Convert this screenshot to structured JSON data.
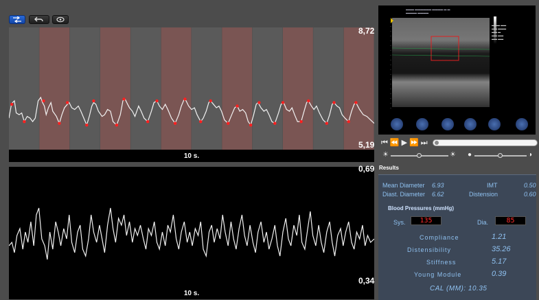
{
  "toolbar": {
    "buttons": [
      {
        "icon": "compare-icon",
        "active": true
      },
      {
        "icon": "undo-icon",
        "active": false
      },
      {
        "icon": "eye-icon",
        "active": false
      }
    ]
  },
  "top_chart": {
    "max_label": "8,72",
    "min_label": "5,19",
    "caption": "10 s.",
    "ylim": [
      5.19,
      8.72
    ],
    "duration_s": 10,
    "band_colors": [
      "#5a5a5a",
      "#7a5553"
    ],
    "bands": [
      0,
      1,
      0,
      1,
      0,
      1,
      0,
      1,
      0,
      1,
      0,
      1
    ],
    "series": [
      [
        0.0,
        6.1
      ],
      [
        0.06,
        6.45
      ],
      [
        0.1,
        6.55
      ],
      [
        0.15,
        6.6
      ],
      [
        0.2,
        6.25
      ],
      [
        0.28,
        6.2
      ],
      [
        0.35,
        6.25
      ],
      [
        0.42,
        6.0
      ],
      [
        0.5,
        6.15
      ],
      [
        0.58,
        6.1
      ],
      [
        0.65,
        6.0
      ],
      [
        0.72,
        6.1
      ],
      [
        0.8,
        6.6
      ],
      [
        0.87,
        6.7
      ],
      [
        0.92,
        6.55
      ],
      [
        0.97,
        6.45
      ],
      [
        1.02,
        6.2
      ],
      [
        1.08,
        6.4
      ],
      [
        1.15,
        6.55
      ],
      [
        1.2,
        6.3
      ],
      [
        1.3,
        6.15
      ],
      [
        1.38,
        5.95
      ],
      [
        1.45,
        6.2
      ],
      [
        1.52,
        6.4
      ],
      [
        1.6,
        6.5
      ],
      [
        1.65,
        6.55
      ],
      [
        1.72,
        6.4
      ],
      [
        1.8,
        6.35
      ],
      [
        1.9,
        6.45
      ],
      [
        1.97,
        6.3
      ],
      [
        2.05,
        6.1
      ],
      [
        2.13,
        5.9
      ],
      [
        2.2,
        6.15
      ],
      [
        2.27,
        6.45
      ],
      [
        2.32,
        6.55
      ],
      [
        2.38,
        6.5
      ],
      [
        2.45,
        6.3
      ],
      [
        2.55,
        6.15
      ],
      [
        2.62,
        6.2
      ],
      [
        2.7,
        6.35
      ],
      [
        2.78,
        6.3
      ],
      [
        2.85,
        6.0
      ],
      [
        2.95,
        5.9
      ],
      [
        3.05,
        6.2
      ],
      [
        3.12,
        6.6
      ],
      [
        3.18,
        6.65
      ],
      [
        3.25,
        6.5
      ],
      [
        3.3,
        6.4
      ],
      [
        3.38,
        6.3
      ],
      [
        3.45,
        6.15
      ],
      [
        3.55,
        6.45
      ],
      [
        3.62,
        6.3
      ],
      [
        3.7,
        6.1
      ],
      [
        3.8,
        6.0
      ],
      [
        3.9,
        6.3
      ],
      [
        3.97,
        6.55
      ],
      [
        4.05,
        6.6
      ],
      [
        4.12,
        6.45
      ],
      [
        4.2,
        6.35
      ],
      [
        4.28,
        6.5
      ],
      [
        4.35,
        6.35
      ],
      [
        4.45,
        6.1
      ],
      [
        4.55,
        5.95
      ],
      [
        4.65,
        6.2
      ],
      [
        4.72,
        6.45
      ],
      [
        4.8,
        6.65
      ],
      [
        4.85,
        6.6
      ],
      [
        4.92,
        6.45
      ],
      [
        5.0,
        6.35
      ],
      [
        5.08,
        6.4
      ],
      [
        5.15,
        6.2
      ],
      [
        5.25,
        6.0
      ],
      [
        5.32,
        6.1
      ],
      [
        5.4,
        6.3
      ],
      [
        5.47,
        6.55
      ],
      [
        5.52,
        6.6
      ],
      [
        5.6,
        6.5
      ],
      [
        5.68,
        6.4
      ],
      [
        5.75,
        6.45
      ],
      [
        5.82,
        6.3
      ],
      [
        5.9,
        6.05
      ],
      [
        6.0,
        5.95
      ],
      [
        6.1,
        6.2
      ],
      [
        6.18,
        6.4
      ],
      [
        6.25,
        6.45
      ],
      [
        6.32,
        6.3
      ],
      [
        6.4,
        6.35
      ],
      [
        6.48,
        6.25
      ],
      [
        6.55,
        6.0
      ],
      [
        6.62,
        5.9
      ],
      [
        6.7,
        6.2
      ],
      [
        6.77,
        6.5
      ],
      [
        6.82,
        6.55
      ],
      [
        6.9,
        6.4
      ],
      [
        6.98,
        6.3
      ],
      [
        7.05,
        6.35
      ],
      [
        7.12,
        6.2
      ],
      [
        7.2,
        6.0
      ],
      [
        7.28,
        5.95
      ],
      [
        7.38,
        6.25
      ],
      [
        7.45,
        6.5
      ],
      [
        7.52,
        6.55
      ],
      [
        7.6,
        6.35
      ],
      [
        7.68,
        6.3
      ],
      [
        7.75,
        6.4
      ],
      [
        7.82,
        6.2
      ],
      [
        7.9,
        6.0
      ],
      [
        8.0,
        6.0
      ],
      [
        8.08,
        6.3
      ],
      [
        8.15,
        6.55
      ],
      [
        8.2,
        6.6
      ],
      [
        8.28,
        6.45
      ],
      [
        8.35,
        6.35
      ],
      [
        8.42,
        6.45
      ],
      [
        8.5,
        6.25
      ],
      [
        8.6,
        6.05
      ],
      [
        8.7,
        5.95
      ],
      [
        8.78,
        6.2
      ],
      [
        8.85,
        6.5
      ],
      [
        8.9,
        6.55
      ],
      [
        8.98,
        6.45
      ],
      [
        9.05,
        6.4
      ],
      [
        9.12,
        6.2
      ],
      [
        9.2,
        6.1
      ],
      [
        9.3,
        6.0
      ],
      [
        9.38,
        6.3
      ],
      [
        9.45,
        6.5
      ],
      [
        9.5,
        6.55
      ],
      [
        9.6,
        6.35
      ],
      [
        9.7,
        6.2
      ],
      [
        9.8,
        6.15
      ],
      [
        9.9,
        6.05
      ],
      [
        10.0,
        5.95
      ]
    ],
    "markers": [
      [
        0.08,
        6.5
      ],
      [
        0.95,
        6.6
      ],
      [
        1.6,
        6.55
      ],
      [
        2.32,
        6.6
      ],
      [
        3.15,
        6.65
      ],
      [
        4.05,
        6.6
      ],
      [
        4.82,
        6.65
      ],
      [
        5.52,
        6.6
      ],
      [
        6.25,
        6.45
      ],
      [
        6.85,
        6.55
      ],
      [
        7.5,
        6.55
      ],
      [
        8.2,
        6.6
      ],
      [
        8.9,
        6.55
      ],
      [
        9.5,
        6.55
      ],
      [
        0.42,
        6.0
      ],
      [
        1.38,
        5.95
      ],
      [
        2.13,
        5.9
      ],
      [
        2.95,
        5.9
      ],
      [
        3.8,
        6.0
      ],
      [
        4.55,
        5.95
      ],
      [
        5.25,
        6.0
      ],
      [
        6.0,
        5.95
      ],
      [
        6.62,
        5.9
      ],
      [
        7.28,
        5.95
      ],
      [
        8.0,
        6.0
      ],
      [
        8.7,
        5.95
      ],
      [
        9.3,
        6.0
      ]
    ]
  },
  "bottom_chart": {
    "max_label": "0,69",
    "min_label": "0,34",
    "caption": "10 s.",
    "ylim": [
      0.34,
      0.69
    ],
    "duration_s": 10,
    "series": [
      [
        0.0,
        0.46
      ],
      [
        0.08,
        0.47
      ],
      [
        0.15,
        0.44
      ],
      [
        0.22,
        0.49
      ],
      [
        0.3,
        0.51
      ],
      [
        0.38,
        0.45
      ],
      [
        0.45,
        0.5
      ],
      [
        0.52,
        0.47
      ],
      [
        0.6,
        0.53
      ],
      [
        0.68,
        0.46
      ],
      [
        0.75,
        0.55
      ],
      [
        0.82,
        0.57
      ],
      [
        0.9,
        0.48
      ],
      [
        0.98,
        0.46
      ],
      [
        1.05,
        0.42
      ],
      [
        1.12,
        0.5
      ],
      [
        1.2,
        0.45
      ],
      [
        1.28,
        0.53
      ],
      [
        1.35,
        0.5
      ],
      [
        1.42,
        0.46
      ],
      [
        1.5,
        0.51
      ],
      [
        1.58,
        0.48
      ],
      [
        1.65,
        0.55
      ],
      [
        1.72,
        0.47
      ],
      [
        1.8,
        0.44
      ],
      [
        1.88,
        0.5
      ],
      [
        1.95,
        0.52
      ],
      [
        2.02,
        0.45
      ],
      [
        2.1,
        0.43
      ],
      [
        2.18,
        0.48
      ],
      [
        2.25,
        0.55
      ],
      [
        2.32,
        0.5
      ],
      [
        2.4,
        0.47
      ],
      [
        2.48,
        0.52
      ],
      [
        2.55,
        0.48
      ],
      [
        2.62,
        0.44
      ],
      [
        2.7,
        0.52
      ],
      [
        2.78,
        0.57
      ],
      [
        2.85,
        0.51
      ],
      [
        2.92,
        0.47
      ],
      [
        3.0,
        0.54
      ],
      [
        3.08,
        0.52
      ],
      [
        3.15,
        0.55
      ],
      [
        3.22,
        0.49
      ],
      [
        3.3,
        0.53
      ],
      [
        3.38,
        0.47
      ],
      [
        3.45,
        0.51
      ],
      [
        3.52,
        0.49
      ],
      [
        3.6,
        0.52
      ],
      [
        3.68,
        0.48
      ],
      [
        3.75,
        0.45
      ],
      [
        3.82,
        0.51
      ],
      [
        3.9,
        0.49
      ],
      [
        3.98,
        0.53
      ],
      [
        4.05,
        0.47
      ],
      [
        4.12,
        0.45
      ],
      [
        4.2,
        0.5
      ],
      [
        4.28,
        0.46
      ],
      [
        4.35,
        0.52
      ],
      [
        4.42,
        0.5
      ],
      [
        4.5,
        0.55
      ],
      [
        4.58,
        0.48
      ],
      [
        4.65,
        0.45
      ],
      [
        4.72,
        0.5
      ],
      [
        4.8,
        0.53
      ],
      [
        4.88,
        0.47
      ],
      [
        4.95,
        0.5
      ],
      [
        5.02,
        0.46
      ],
      [
        5.1,
        0.51
      ],
      [
        5.18,
        0.49
      ],
      [
        5.25,
        0.53
      ],
      [
        5.32,
        0.45
      ],
      [
        5.4,
        0.43
      ],
      [
        5.48,
        0.5
      ],
      [
        5.55,
        0.52
      ],
      [
        5.62,
        0.47
      ],
      [
        5.7,
        0.51
      ],
      [
        5.78,
        0.48
      ],
      [
        5.85,
        0.55
      ],
      [
        5.92,
        0.5
      ],
      [
        6.0,
        0.46
      ],
      [
        6.08,
        0.53
      ],
      [
        6.15,
        0.48
      ],
      [
        6.22,
        0.45
      ],
      [
        6.3,
        0.51
      ],
      [
        6.38,
        0.55
      ],
      [
        6.45,
        0.49
      ],
      [
        6.52,
        0.46
      ],
      [
        6.6,
        0.52
      ],
      [
        6.68,
        0.47
      ],
      [
        6.75,
        0.44
      ],
      [
        6.82,
        0.5
      ],
      [
        6.9,
        0.53
      ],
      [
        6.98,
        0.47
      ],
      [
        7.05,
        0.5
      ],
      [
        7.12,
        0.45
      ],
      [
        7.2,
        0.48
      ],
      [
        7.28,
        0.52
      ],
      [
        7.35,
        0.46
      ],
      [
        7.42,
        0.43
      ],
      [
        7.5,
        0.5
      ],
      [
        7.58,
        0.54
      ],
      [
        7.65,
        0.48
      ],
      [
        7.72,
        0.46
      ],
      [
        7.8,
        0.52
      ],
      [
        7.88,
        0.49
      ],
      [
        7.95,
        0.55
      ],
      [
        8.02,
        0.47
      ],
      [
        8.1,
        0.45
      ],
      [
        8.18,
        0.51
      ],
      [
        8.25,
        0.56
      ],
      [
        8.32,
        0.49
      ],
      [
        8.4,
        0.46
      ],
      [
        8.48,
        0.52
      ],
      [
        8.55,
        0.47
      ],
      [
        8.62,
        0.44
      ],
      [
        8.7,
        0.5
      ],
      [
        8.78,
        0.53
      ],
      [
        8.85,
        0.47
      ],
      [
        8.92,
        0.43
      ],
      [
        9.0,
        0.49
      ],
      [
        9.08,
        0.51
      ],
      [
        9.15,
        0.46
      ],
      [
        9.22,
        0.5
      ],
      [
        9.3,
        0.53
      ],
      [
        9.38,
        0.47
      ],
      [
        9.45,
        0.45
      ],
      [
        9.52,
        0.5
      ],
      [
        9.6,
        0.48
      ],
      [
        9.68,
        0.52
      ],
      [
        9.75,
        0.46
      ],
      [
        9.82,
        0.49
      ],
      [
        9.9,
        0.47
      ],
      [
        10.0,
        0.48
      ]
    ]
  },
  "player": {
    "icons": [
      "skip-start-icon",
      "step-back-icon",
      "play-icon",
      "step-forward-icon",
      "skip-end-icon"
    ]
  },
  "results": {
    "title": "Results",
    "mean_diameter_label": "Mean Diameter",
    "mean_diameter_value": "6.93",
    "diast_diameter_label": "Diast. Diameter",
    "diast_diameter_value": "6.62",
    "imt_label": "IMT",
    "imt_value": "0.50",
    "distension_label": "Distension",
    "distension_value": "0.60",
    "bp_title": "Blood Pressures (mmHg)",
    "sys_label": "Sys.",
    "sys_value": "135",
    "dia_label": "Dia.",
    "dia_value": "85",
    "compliance_label": "Compliance",
    "compliance_value": "1.21",
    "distensibility_label": "Distensibility",
    "distensibility_value": "35.26",
    "stiffness_label": "Stiffness",
    "stiffness_value": "5.17",
    "young_label": "Young Module",
    "young_value": "0.39",
    "cal": "CAL (MM): 10.35"
  }
}
